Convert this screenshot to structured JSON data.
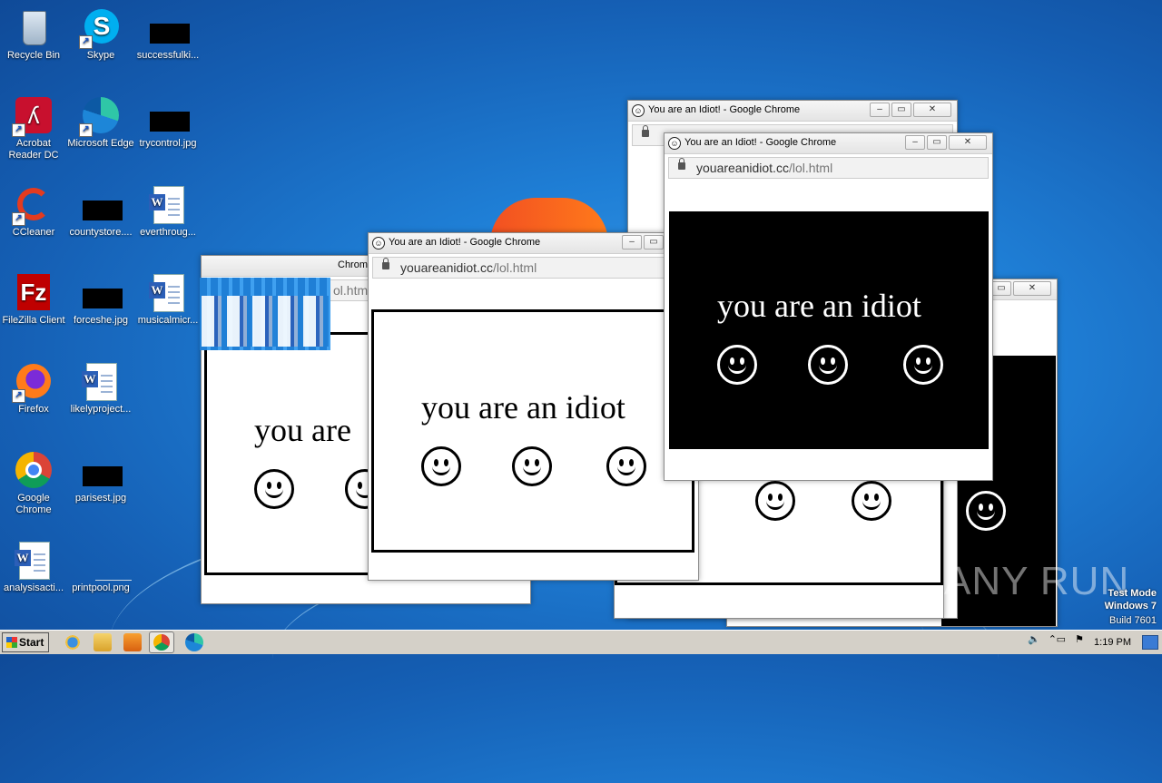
{
  "desktop": {
    "icons": [
      {
        "label": "Recycle Bin",
        "icon": "recycle-bin-icon"
      },
      {
        "label": "Skype",
        "icon": "skype-icon"
      },
      {
        "label": "successfulki...",
        "icon": "image-file-icon"
      },
      {
        "label": "Acrobat Reader DC",
        "icon": "acrobat-icon"
      },
      {
        "label": "Microsoft Edge",
        "icon": "edge-icon"
      },
      {
        "label": "trycontrol.jpg",
        "icon": "image-file-icon"
      },
      {
        "label": "CCleaner",
        "icon": "ccleaner-icon"
      },
      {
        "label": "countystore....",
        "icon": "image-file-icon"
      },
      {
        "label": "everthroug...",
        "icon": "word-doc-icon"
      },
      {
        "label": "FileZilla Client",
        "icon": "filezilla-icon"
      },
      {
        "label": "forceshe.jpg",
        "icon": "image-file-icon"
      },
      {
        "label": "musicalmicr...",
        "icon": "word-doc-icon"
      },
      {
        "label": "Firefox",
        "icon": "firefox-icon"
      },
      {
        "label": "likelyproject...",
        "icon": "word-doc-icon"
      },
      {
        "label": "Google Chrome",
        "icon": "chrome-icon"
      },
      {
        "label": "parisest.jpg",
        "icon": "image-file-icon"
      },
      {
        "label": "analysisacti...",
        "icon": "word-doc-icon"
      },
      {
        "label": "printpool.png",
        "icon": "image-file-icon"
      }
    ]
  },
  "browser": {
    "title": "You are an Idiot! - Google Chrome",
    "url_host": "youareanidiot.cc",
    "url_path": "/lol.html",
    "truncated_title": "Chrome",
    "truncated_url": "ol.htm",
    "phrase": "you are an idiot",
    "phrase_partial": "you are",
    "phrase_tail": "ot"
  },
  "taskbar": {
    "start_label": "Start",
    "clock": "1:19 PM",
    "pinned": [
      "internet-explorer-icon",
      "explorer-icon",
      "media-player-icon",
      "chrome-icon",
      "edge-icon"
    ]
  },
  "watermark": {
    "line1": "Test Mode",
    "line2": "Windows 7",
    "line3": "Build 7601",
    "brand": "ANY RUN"
  },
  "colors": {
    "desktop": "#1f7fd6",
    "taskbar": "#d4d0c8",
    "panel_dark": "#000000"
  }
}
